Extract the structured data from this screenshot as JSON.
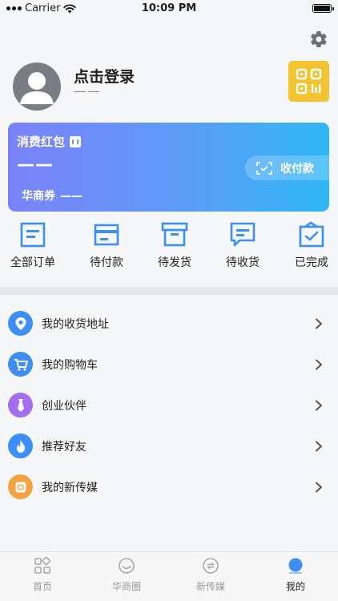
{
  "status_bar": {
    "carrier": "Carrier",
    "time": "10:09 PM"
  },
  "profile": {
    "login_label": "点击登录",
    "sub_label": "——"
  },
  "wallet": {
    "title": "消费红包",
    "amount": "——",
    "coupon_label": "华商券",
    "coupon_value": "——",
    "pay_button_label": "收付款"
  },
  "orders": [
    {
      "label": "全部订单",
      "icon": "order-list-icon"
    },
    {
      "label": "待付款",
      "icon": "wallet-icon"
    },
    {
      "label": "待发货",
      "icon": "box-icon"
    },
    {
      "label": "待收货",
      "icon": "message-box-icon"
    },
    {
      "label": "已完成",
      "icon": "completed-box-icon"
    }
  ],
  "menu": [
    {
      "label": "我的收货地址",
      "icon": "location-pin-icon",
      "color": "#3d8ef5"
    },
    {
      "label": "我的购物车",
      "icon": "cart-icon",
      "color": "#3d8ef5"
    },
    {
      "label": "创业伙伴",
      "icon": "tie-icon",
      "color": "#a46ef0"
    },
    {
      "label": "推荐好友",
      "icon": "flame-icon",
      "color": "#3d8ef5"
    },
    {
      "label": "我的新传媒",
      "icon": "media-icon",
      "color": "#f5a341"
    }
  ],
  "tabbar": [
    {
      "label": "首页",
      "icon": "home-grid-icon",
      "active": false
    },
    {
      "label": "华商圈",
      "icon": "circle-chat-icon",
      "active": false
    },
    {
      "label": "新传媒",
      "icon": "refresh-media-icon",
      "active": false
    },
    {
      "label": "我的",
      "icon": "profile-dot-icon",
      "active": true
    }
  ],
  "colors": {
    "accent": "#3d8ef5",
    "qr_button": "#f4c430",
    "wallet_start": "#7b82f8",
    "wallet_end": "#2fb7f7"
  }
}
